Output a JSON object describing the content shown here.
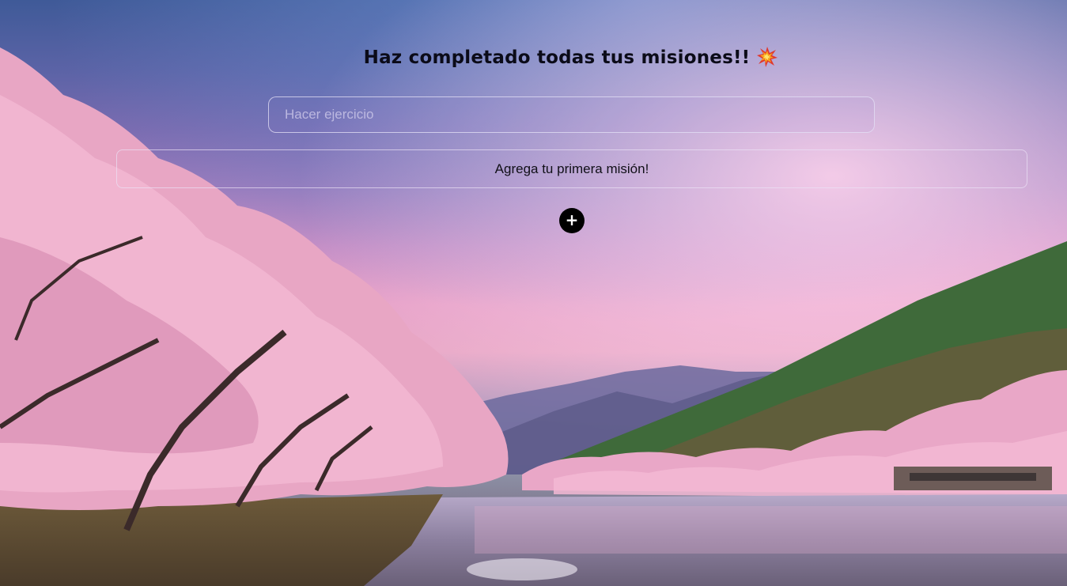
{
  "header": {
    "title": "Haz completado todas tus misiones!!",
    "emoji_icon": "collision-icon"
  },
  "mission_input": {
    "value": "",
    "placeholder": "Hacer ejercicio"
  },
  "mission_list": {
    "empty_message": "Agrega tu primera misión!"
  },
  "add_button": {
    "label": "+",
    "icon": "plus-icon"
  },
  "background": {
    "icon": "cherry-blossom-landscape",
    "accent_color": "#000000"
  }
}
